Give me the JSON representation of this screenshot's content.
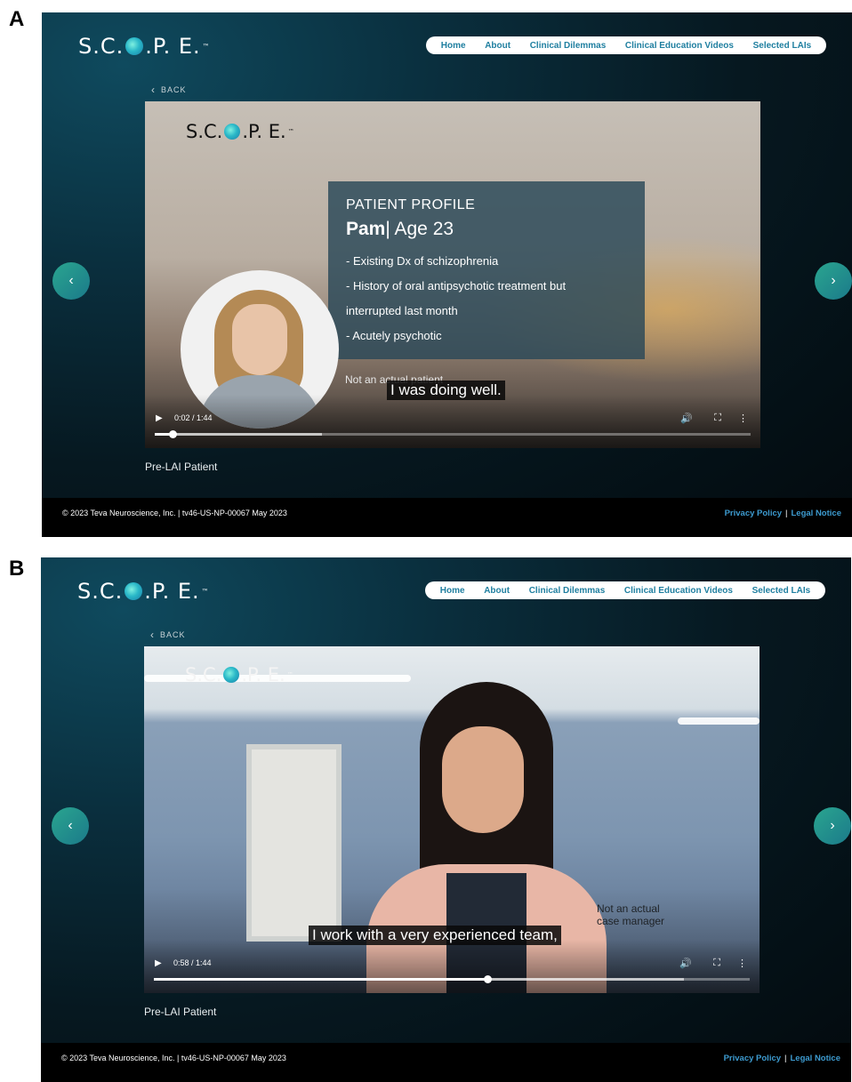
{
  "panels": [
    {
      "letter": "A",
      "logo": {
        "left": "S.C.",
        "right": ".P. E.",
        "tm": "™"
      },
      "nav": [
        "Home",
        "About",
        "Clinical Dilemmas",
        "Clinical Education Videos",
        "Selected LAIs"
      ],
      "back_label": "BACK",
      "video": {
        "logo": {
          "left": "S.C.",
          "right": ".P. E.",
          "tm": "™"
        },
        "profile": {
          "title": "PATIENT PROFILE",
          "name": "Pam",
          "age": "| Age 23",
          "lines": [
            "- Existing Dx of schizophrenia",
            "- History of oral antipsychotic treatment but",
            "interrupted last month",
            "- Acutely psychotic"
          ]
        },
        "disclaimer": "Not an actual patient",
        "caption": "I was doing well.",
        "time": "0:02 / 1:44",
        "progress": 0.03,
        "buffered": 0.28
      },
      "video_label": "Pre-LAI Patient",
      "footer": {
        "copyright": "© 2023 Teva Neuroscience, Inc.  |  tv46-US-NP-00067 May 2023",
        "privacy": "Privacy Policy",
        "separator": "|",
        "legal": "Legal Notice"
      }
    },
    {
      "letter": "B",
      "logo": {
        "left": "S.C.",
        "right": ".P. E.",
        "tm": "™"
      },
      "nav": [
        "Home",
        "About",
        "Clinical Dilemmas",
        "Clinical Education Videos",
        "Selected LAIs"
      ],
      "back_label": "BACK",
      "video": {
        "logo": {
          "left": "S.C.",
          "right": ".P. E.",
          "tm": "™"
        },
        "disclaimer_line1": "Not an actual",
        "disclaimer_line2": "case manager",
        "caption": "I work with a very experienced team,",
        "time": "0:58 / 1:44",
        "progress": 0.56,
        "buffered": 0.89
      },
      "video_label": "Pre-LAI Patient",
      "footer": {
        "copyright": "© 2023 Teva Neuroscience, Inc.  |  tv46-US-NP-00067 May 2023",
        "privacy": "Privacy Policy",
        "separator": "|",
        "legal": "Legal Notice"
      }
    }
  ],
  "icons": {
    "back": "‹",
    "prev": "‹",
    "next": "›",
    "play": "▶",
    "volume": "🔊",
    "fullscreen": "⛶",
    "more": "⋮"
  },
  "colors": {
    "accent": "#1f7fa0",
    "nav_bg": "#ffffff",
    "link": "#3d9bd0",
    "arrow_button": "#1b7a8a"
  }
}
